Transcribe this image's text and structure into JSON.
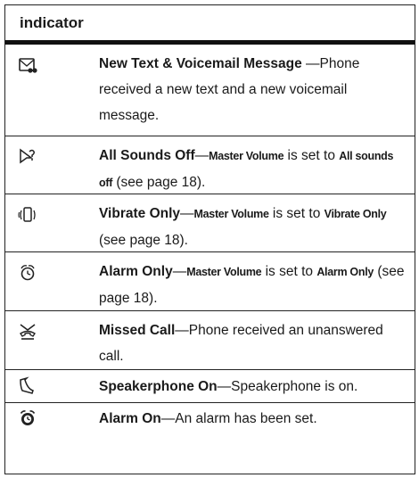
{
  "header": {
    "label": "indicator"
  },
  "rows": [
    {
      "icon": "new-text-voicemail-icon",
      "title": "New Text & Voicemail Message",
      "desc": " —Phone received a new text and a new voicemail message."
    },
    {
      "icon": "all-sounds-off-icon",
      "title": "All Sounds Off",
      "desc_parts": [
        "—",
        "Master Volume",
        " is set to ",
        "All sounds off",
        " (see page 18)."
      ]
    },
    {
      "icon": "vibrate-only-icon",
      "title": "Vibrate Only",
      "desc_parts": [
        "—",
        "Master Volume",
        " is set to ",
        "Vibrate Only",
        " (see page 18)."
      ]
    },
    {
      "icon": "alarm-only-icon",
      "title": "Alarm Only",
      "desc_parts": [
        "—",
        "Master Volume",
        " is set to ",
        "Alarm Only",
        " (see page 18)."
      ]
    },
    {
      "icon": "missed-call-icon",
      "title": "Missed Call",
      "desc": "—Phone received an unanswered call."
    },
    {
      "icon": "speakerphone-on-icon",
      "title": "Speakerphone On",
      "desc": "—Speakerphone is on."
    },
    {
      "icon": "alarm-on-icon",
      "title": "Alarm On",
      "desc": "—An alarm has been set."
    }
  ]
}
